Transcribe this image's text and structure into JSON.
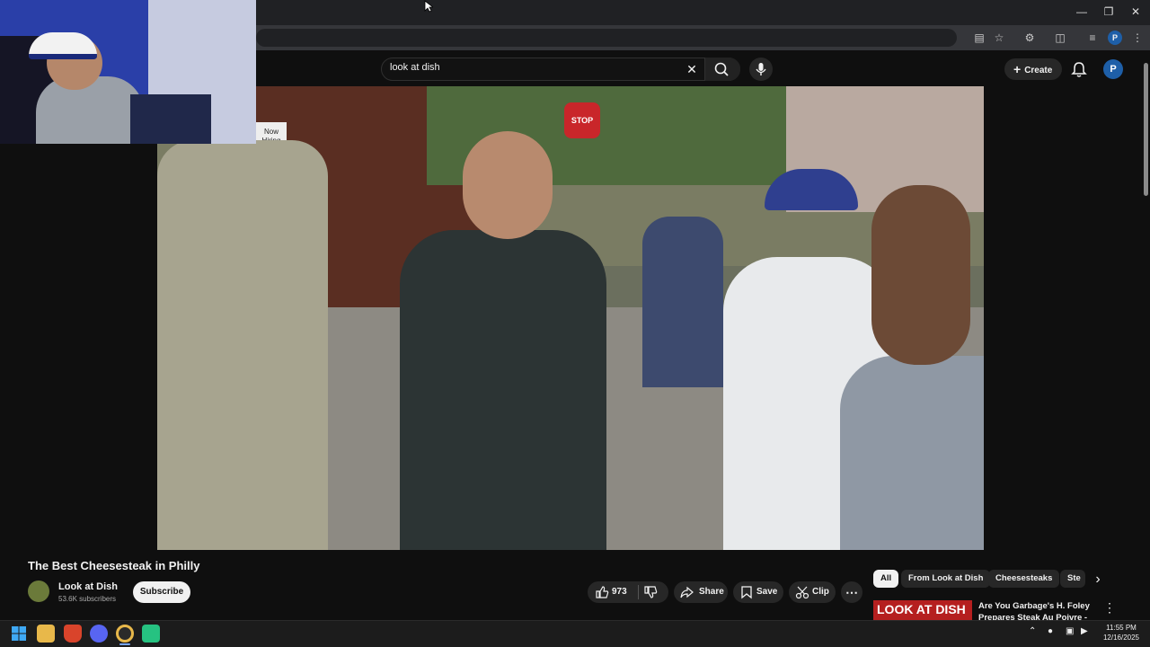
{
  "search": {
    "query": "look at dish"
  },
  "header": {
    "create_label": "Create",
    "avatar_letter": "P"
  },
  "browser": {
    "profile_letter": "P"
  },
  "video": {
    "title": "The Best Cheesesteak in Philly",
    "sign_now_hiring": "Now Hiring",
    "sign_stop": "STOP"
  },
  "channel": {
    "name": "Look at Dish",
    "subscribers": "53.6K subscribers",
    "subscribe_label": "Subscribe"
  },
  "actions": {
    "like_count": "973",
    "share_label": "Share",
    "save_label": "Save",
    "clip_label": "Clip"
  },
  "chips": [
    "All",
    "From Look at Dish",
    "Cheesesteaks",
    "Ste"
  ],
  "suggestion": {
    "thumb_text": "LOOK AT DISH",
    "title": "Are You Garbage's H. Foley Prepares Steak Au Poivre - Lo"
  },
  "taskbar": {
    "time": "11:55 PM",
    "date": "12/16/2025"
  },
  "colors": {
    "background": "#0f0f0f",
    "pill": "#272727",
    "subscribe": "#f1f1f1",
    "avatar": "#1e5fa8"
  }
}
